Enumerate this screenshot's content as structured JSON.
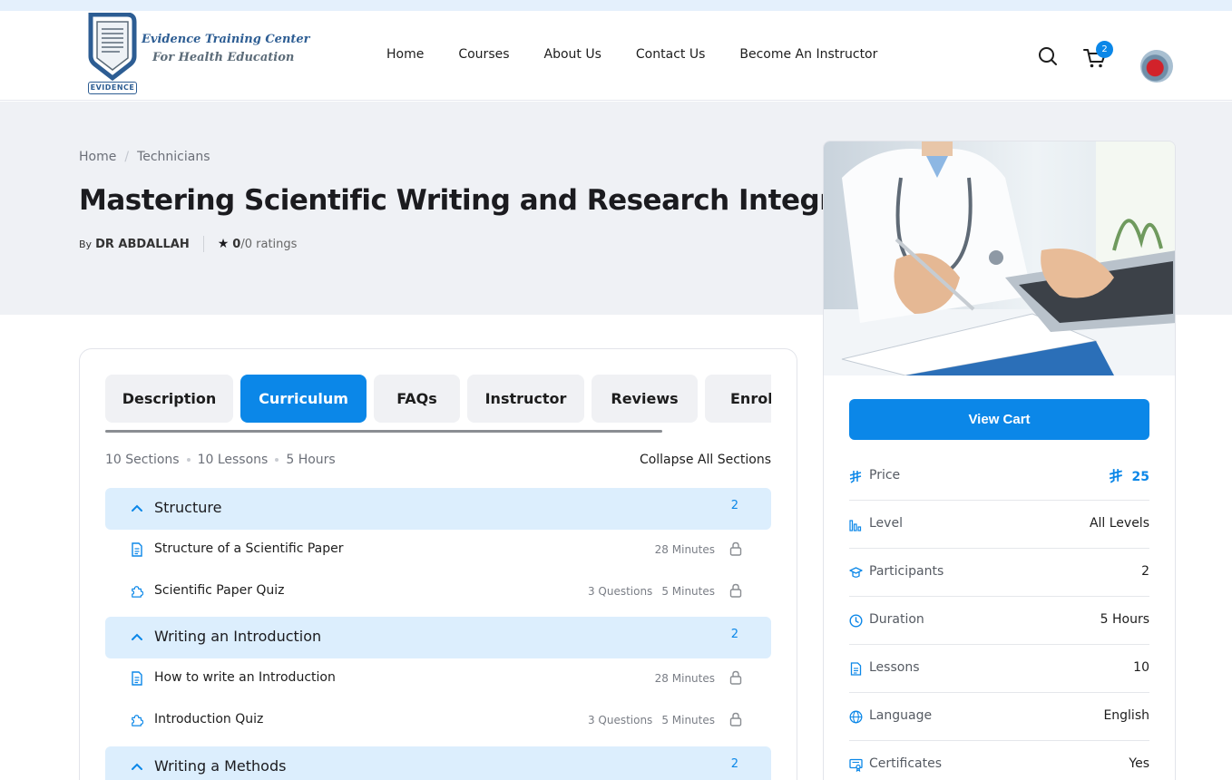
{
  "brand": {
    "line1": "Evidence Training Center",
    "line2": "For Health Education",
    "badge": "EVIDENCE"
  },
  "nav": {
    "items": [
      "Home",
      "Courses",
      "About Us",
      "Contact Us",
      "Become An Instructor"
    ]
  },
  "header": {
    "cart_count": "2",
    "search_icon": "search-icon",
    "cart_icon": "cart-icon"
  },
  "breadcrumb": {
    "home": "Home",
    "category": "Technicians"
  },
  "course": {
    "title": "Mastering Scientific Writing and Research Integrity",
    "by_label": "By",
    "author": "DR ABDALLAH",
    "rating": "0",
    "rating_suffix": "/0 ratings"
  },
  "tabs": [
    {
      "label": "Description"
    },
    {
      "label": "Curriculum",
      "active": true
    },
    {
      "label": "FAQs"
    },
    {
      "label": "Instructor"
    },
    {
      "label": "Reviews"
    },
    {
      "label": "Enrolled"
    }
  ],
  "curriculum": {
    "sections_count": "10 Sections",
    "lessons_count": "10 Lessons",
    "hours": "5 Hours",
    "collapse_all": "Collapse All Sections",
    "sections": [
      {
        "name": "Structure",
        "count": "2",
        "items": [
          {
            "type": "lesson",
            "name": "Structure of a Scientific Paper",
            "duration": "28 Minutes"
          },
          {
            "type": "quiz",
            "name": "Scientific Paper Quiz",
            "questions": "3 Questions",
            "duration": "5 Minutes"
          }
        ]
      },
      {
        "name": "Writing an Introduction",
        "count": "2",
        "items": [
          {
            "type": "lesson",
            "name": "How to write an Introduction",
            "duration": "28 Minutes"
          },
          {
            "type": "quiz",
            "name": "Introduction Quiz",
            "questions": "3 Questions",
            "duration": "5 Minutes"
          }
        ]
      },
      {
        "name": "Writing a Methods",
        "count": "2"
      }
    ]
  },
  "sidebar": {
    "view_cart": "View Cart",
    "price_label": "Price",
    "price_value": "25",
    "level_label": "Level",
    "level_value": "All Levels",
    "participants_label": "Participants",
    "participants_value": "2",
    "duration_label": "Duration",
    "duration_value": "5 Hours",
    "lessons_label": "Lessons",
    "lessons_value": "10",
    "language_label": "Language",
    "language_value": "English",
    "certificates_label": "Certificates",
    "certificates_value": "Yes"
  },
  "colors": {
    "accent": "#0b87e8",
    "section_bg": "#dceefd",
    "hero_bg": "#eff1f5"
  }
}
